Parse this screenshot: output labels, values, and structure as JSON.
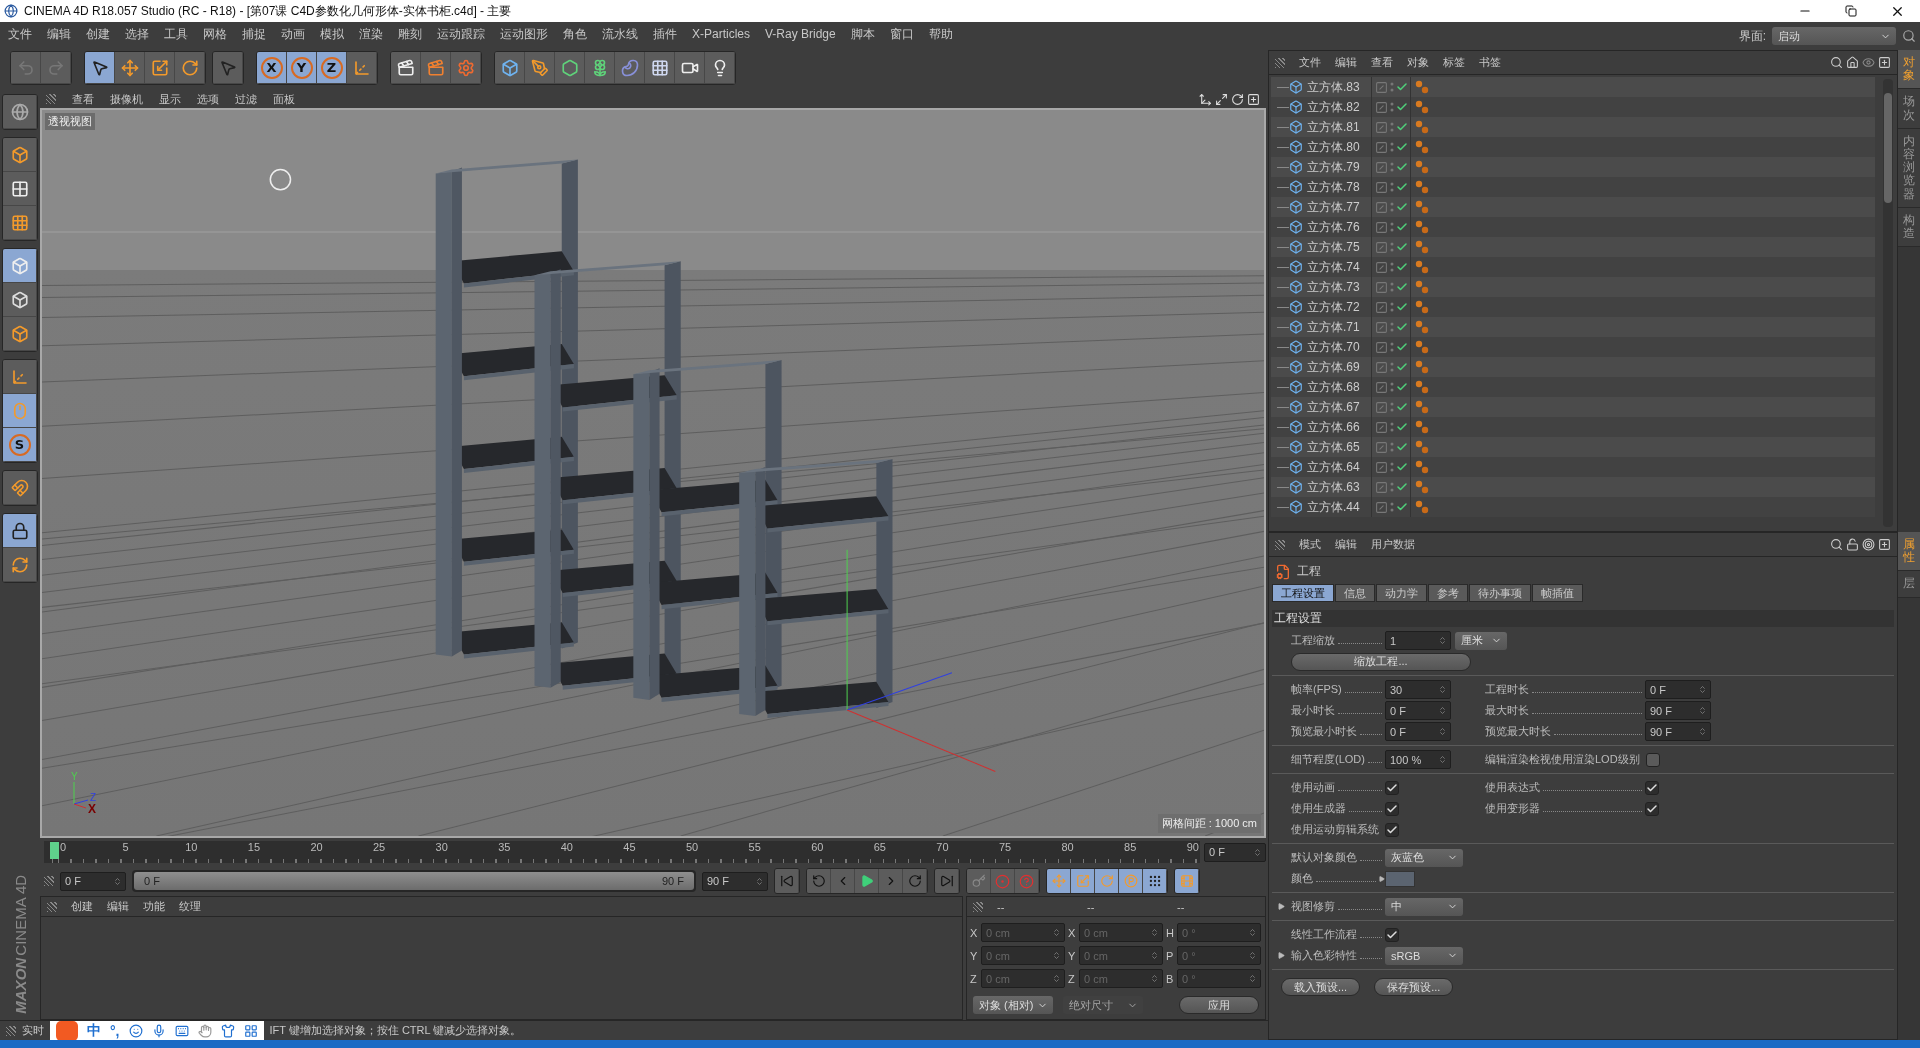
{
  "window": {
    "title": "CINEMA 4D R18.057 Studio (RC - R18) - [第07课   C4D参数化几何形体-实体书柜.c4d] - 主要"
  },
  "menu": [
    "文件",
    "编辑",
    "创建",
    "选择",
    "工具",
    "网格",
    "捕捉",
    "动画",
    "模拟",
    "渲染",
    "雕刻",
    "运动跟踪",
    "运动图形",
    "角色",
    "流水线",
    "插件",
    "X-Particles",
    "V-Ray Bridge",
    "脚本",
    "窗口",
    "帮助"
  ],
  "layout": {
    "label": "界面:",
    "value": "启动"
  },
  "toolbar": [
    [
      {
        "selected": false
      },
      {
        "selected": false
      }
    ],
    [
      {
        "selected": true
      },
      {
        "selected": false
      },
      {
        "selected": false
      },
      {
        "selected": false
      }
    ],
    [
      {
        "selected": false
      }
    ],
    [
      {
        "label": "X",
        "selected": true
      },
      {
        "label": "Y",
        "selected": true
      },
      {
        "label": "Z",
        "selected": true
      },
      {
        "selected": false
      }
    ],
    [
      {
        "selected": false
      },
      {
        "selected": false
      },
      {
        "selected": false
      }
    ],
    [
      {
        "selected": false
      },
      {
        "selected": false
      },
      {
        "selected": false
      },
      {
        "selected": false
      },
      {
        "selected": false
      },
      {
        "selected": false
      },
      {
        "selected": false
      },
      {
        "selected": false
      }
    ]
  ],
  "mode_bar": [
    [
      {
        "selected": false
      }
    ],
    [
      {
        "selected": false
      },
      {
        "selected": false
      },
      {
        "selected": false
      }
    ],
    [
      {
        "selected": true
      },
      {
        "selected": false
      },
      {
        "selected": false
      }
    ],
    [
      {
        "selected": false
      },
      {
        "selected": true
      },
      {
        "label": "S",
        "selected": true
      }
    ],
    [
      {
        "selected": false
      }
    ],
    [
      {
        "selected": true
      },
      {
        "selected": false
      }
    ]
  ],
  "brand": [
    "MAXON",
    "CINEMA 4D"
  ],
  "viewport": {
    "menu": [
      "查看",
      "摄像机",
      "显示",
      "选项",
      "过滤",
      "面板"
    ],
    "camera": "透视视图",
    "grid_spacing": "网格间距 : 1000 cm",
    "axis_labels": [
      "Y",
      "Z",
      "X"
    ]
  },
  "timeline": {
    "labels": [
      "0",
      "5",
      "10",
      "15",
      "20",
      "25",
      "30",
      "35",
      "40",
      "45",
      "50",
      "55",
      "60",
      "65",
      "70",
      "75",
      "80",
      "85",
      "90"
    ],
    "current": "0 F"
  },
  "transport": {
    "start": "0 F",
    "range": {
      "start": "0 F",
      "end": "90 F",
      "level": 1
    },
    "end": "90 F",
    "modes": [
      {
        "selected": true
      },
      {
        "selected": true
      },
      {
        "selected": true
      },
      {
        "selected": true
      },
      {
        "selected": true
      }
    ]
  },
  "materials": {
    "menu": [
      "创建",
      "编辑",
      "功能",
      "纹理"
    ]
  },
  "coordinates": {
    "headers": [
      "--",
      "--",
      "--"
    ],
    "rows": [
      {
        "position_axis": "X",
        "position": "0 cm",
        "size_axis": "X",
        "size": "0 cm",
        "rotation_axis": "H",
        "rotation": "0 °"
      },
      {
        "position_axis": "Y",
        "position": "0 cm",
        "size_axis": "Y",
        "size": "0 cm",
        "rotation_axis": "P",
        "rotation": "0 °"
      },
      {
        "position_axis": "Z",
        "position": "0 cm",
        "size_axis": "Z",
        "size": "0 cm",
        "rotation_axis": "B",
        "rotation": "0 °"
      }
    ],
    "mode": "对象 (相对)",
    "size_mode": {
      "value": "绝对尺寸",
      "disabled": true
    },
    "apply": "应用"
  },
  "status": {
    "text": [
      "实时",
      "IFT 键增加选择对象；按住 CTRL 键减少选择对象。"
    ],
    "ime": [
      "中",
      "°,"
    ]
  },
  "objects": {
    "menu": [
      "文件",
      "编辑",
      "查看",
      "对象",
      "标签",
      "书签"
    ],
    "items": [
      {
        "name": "立方体.83",
        "enabled": true
      },
      {
        "name": "立方体.82",
        "enabled": true
      },
      {
        "name": "立方体.81",
        "enabled": true
      },
      {
        "name": "立方体.80",
        "enabled": true
      },
      {
        "name": "立方体.79",
        "enabled": true
      },
      {
        "name": "立方体.78",
        "enabled": true
      },
      {
        "name": "立方体.77",
        "enabled": true
      },
      {
        "name": "立方体.76",
        "enabled": true
      },
      {
        "name": "立方体.75",
        "enabled": true
      },
      {
        "name": "立方体.74",
        "enabled": true
      },
      {
        "name": "立方体.73",
        "enabled": true
      },
      {
        "name": "立方体.72",
        "enabled": true
      },
      {
        "name": "立方体.71",
        "enabled": true
      },
      {
        "name": "立方体.70",
        "enabled": true
      },
      {
        "name": "立方体.69",
        "enabled": true
      },
      {
        "name": "立方体.68",
        "enabled": true
      },
      {
        "name": "立方体.67",
        "enabled": true
      },
      {
        "name": "立方体.66",
        "enabled": true
      },
      {
        "name": "立方体.65",
        "enabled": true
      },
      {
        "name": "立方体.64",
        "enabled": true
      },
      {
        "name": "立方体.63",
        "enabled": true
      },
      {
        "name": "立方体.44",
        "enabled": true
      }
    ],
    "side_tabs": [
      {
        "label": "对象",
        "selected": true
      },
      {
        "label": "场次",
        "selected": false
      },
      {
        "label": "内容浏览器",
        "selected": false
      },
      {
        "label": "构造",
        "selected": false
      }
    ]
  },
  "attributes": {
    "menu": [
      "模式",
      "编辑",
      "用户数据"
    ],
    "title": "工程",
    "tabs": [
      {
        "label": "工程设置",
        "selected": true
      },
      {
        "label": "信息",
        "selected": false
      },
      {
        "label": "动力学",
        "selected": false
      },
      {
        "label": "参考",
        "selected": false
      },
      {
        "label": "待办事项",
        "selected": false
      },
      {
        "label": "帧插值",
        "selected": false
      }
    ],
    "section": "工程设置",
    "groups": [
      {
        "rows": [
          [
            {
              "kind": "number",
              "label": "工程缩放",
              "value": "1",
              "unit": "厘米"
            }
          ],
          [
            {
              "kind": "button",
              "label": "缩放工程..."
            }
          ]
        ]
      },
      {
        "rows": [
          [
            {
              "kind": "number",
              "label": "帧率(FPS)",
              "value": "30"
            },
            {
              "kind": "number",
              "label": "工程时长",
              "value": "0 F"
            }
          ],
          [
            {
              "kind": "number",
              "label": "最小时长",
              "value": "0 F"
            },
            {
              "kind": "number",
              "label": "最大时长",
              "value": "90 F"
            }
          ],
          [
            {
              "kind": "number",
              "label": "预览最小时长",
              "value": "0 F"
            },
            {
              "kind": "number",
              "label": "预览最大时长",
              "value": "90 F"
            }
          ]
        ]
      },
      {
        "rows": [
          [
            {
              "kind": "number",
              "label": "细节程度(LOD)",
              "value": "100 %"
            },
            {
              "kind": "checkbox",
              "label": "编辑渲染检视使用渲染LOD级别",
              "checked": false
            }
          ]
        ]
      },
      {
        "rows": [
          [
            {
              "kind": "checkbox",
              "label": "使用动画",
              "checked": true
            },
            {
              "kind": "checkbox",
              "label": "使用表达式",
              "checked": true
            }
          ],
          [
            {
              "kind": "checkbox",
              "label": "使用生成器",
              "checked": true
            },
            {
              "kind": "checkbox",
              "label": "使用变形器",
              "checked": true
            }
          ],
          [
            {
              "kind": "checkbox",
              "label": "使用运动剪辑系统",
              "checked": true
            }
          ]
        ]
      },
      {
        "rows": [
          [
            {
              "kind": "dropdown",
              "label": "默认对象颜色",
              "value": "灰蓝色"
            }
          ],
          [
            {
              "kind": "color",
              "label": "颜色",
              "color": "#5b6470"
            }
          ]
        ]
      },
      {
        "rows": [
          [
            {
              "kind": "dropdown",
              "label": "视图修剪",
              "value": "中",
              "expanded": false
            }
          ]
        ]
      },
      {
        "rows": [
          [
            {
              "kind": "checkbox",
              "label": "线性工作流程",
              "checked": true
            }
          ],
          [
            {
              "kind": "dropdown",
              "label": "输入色彩特性",
              "value": "sRGB",
              "expanded": false
            }
          ]
        ]
      }
    ],
    "presets": [
      "载入预设...",
      "保存预设..."
    ],
    "side_tabs": [
      {
        "label": "属性",
        "selected": true
      },
      {
        "label": "层",
        "selected": false
      }
    ]
  }
}
